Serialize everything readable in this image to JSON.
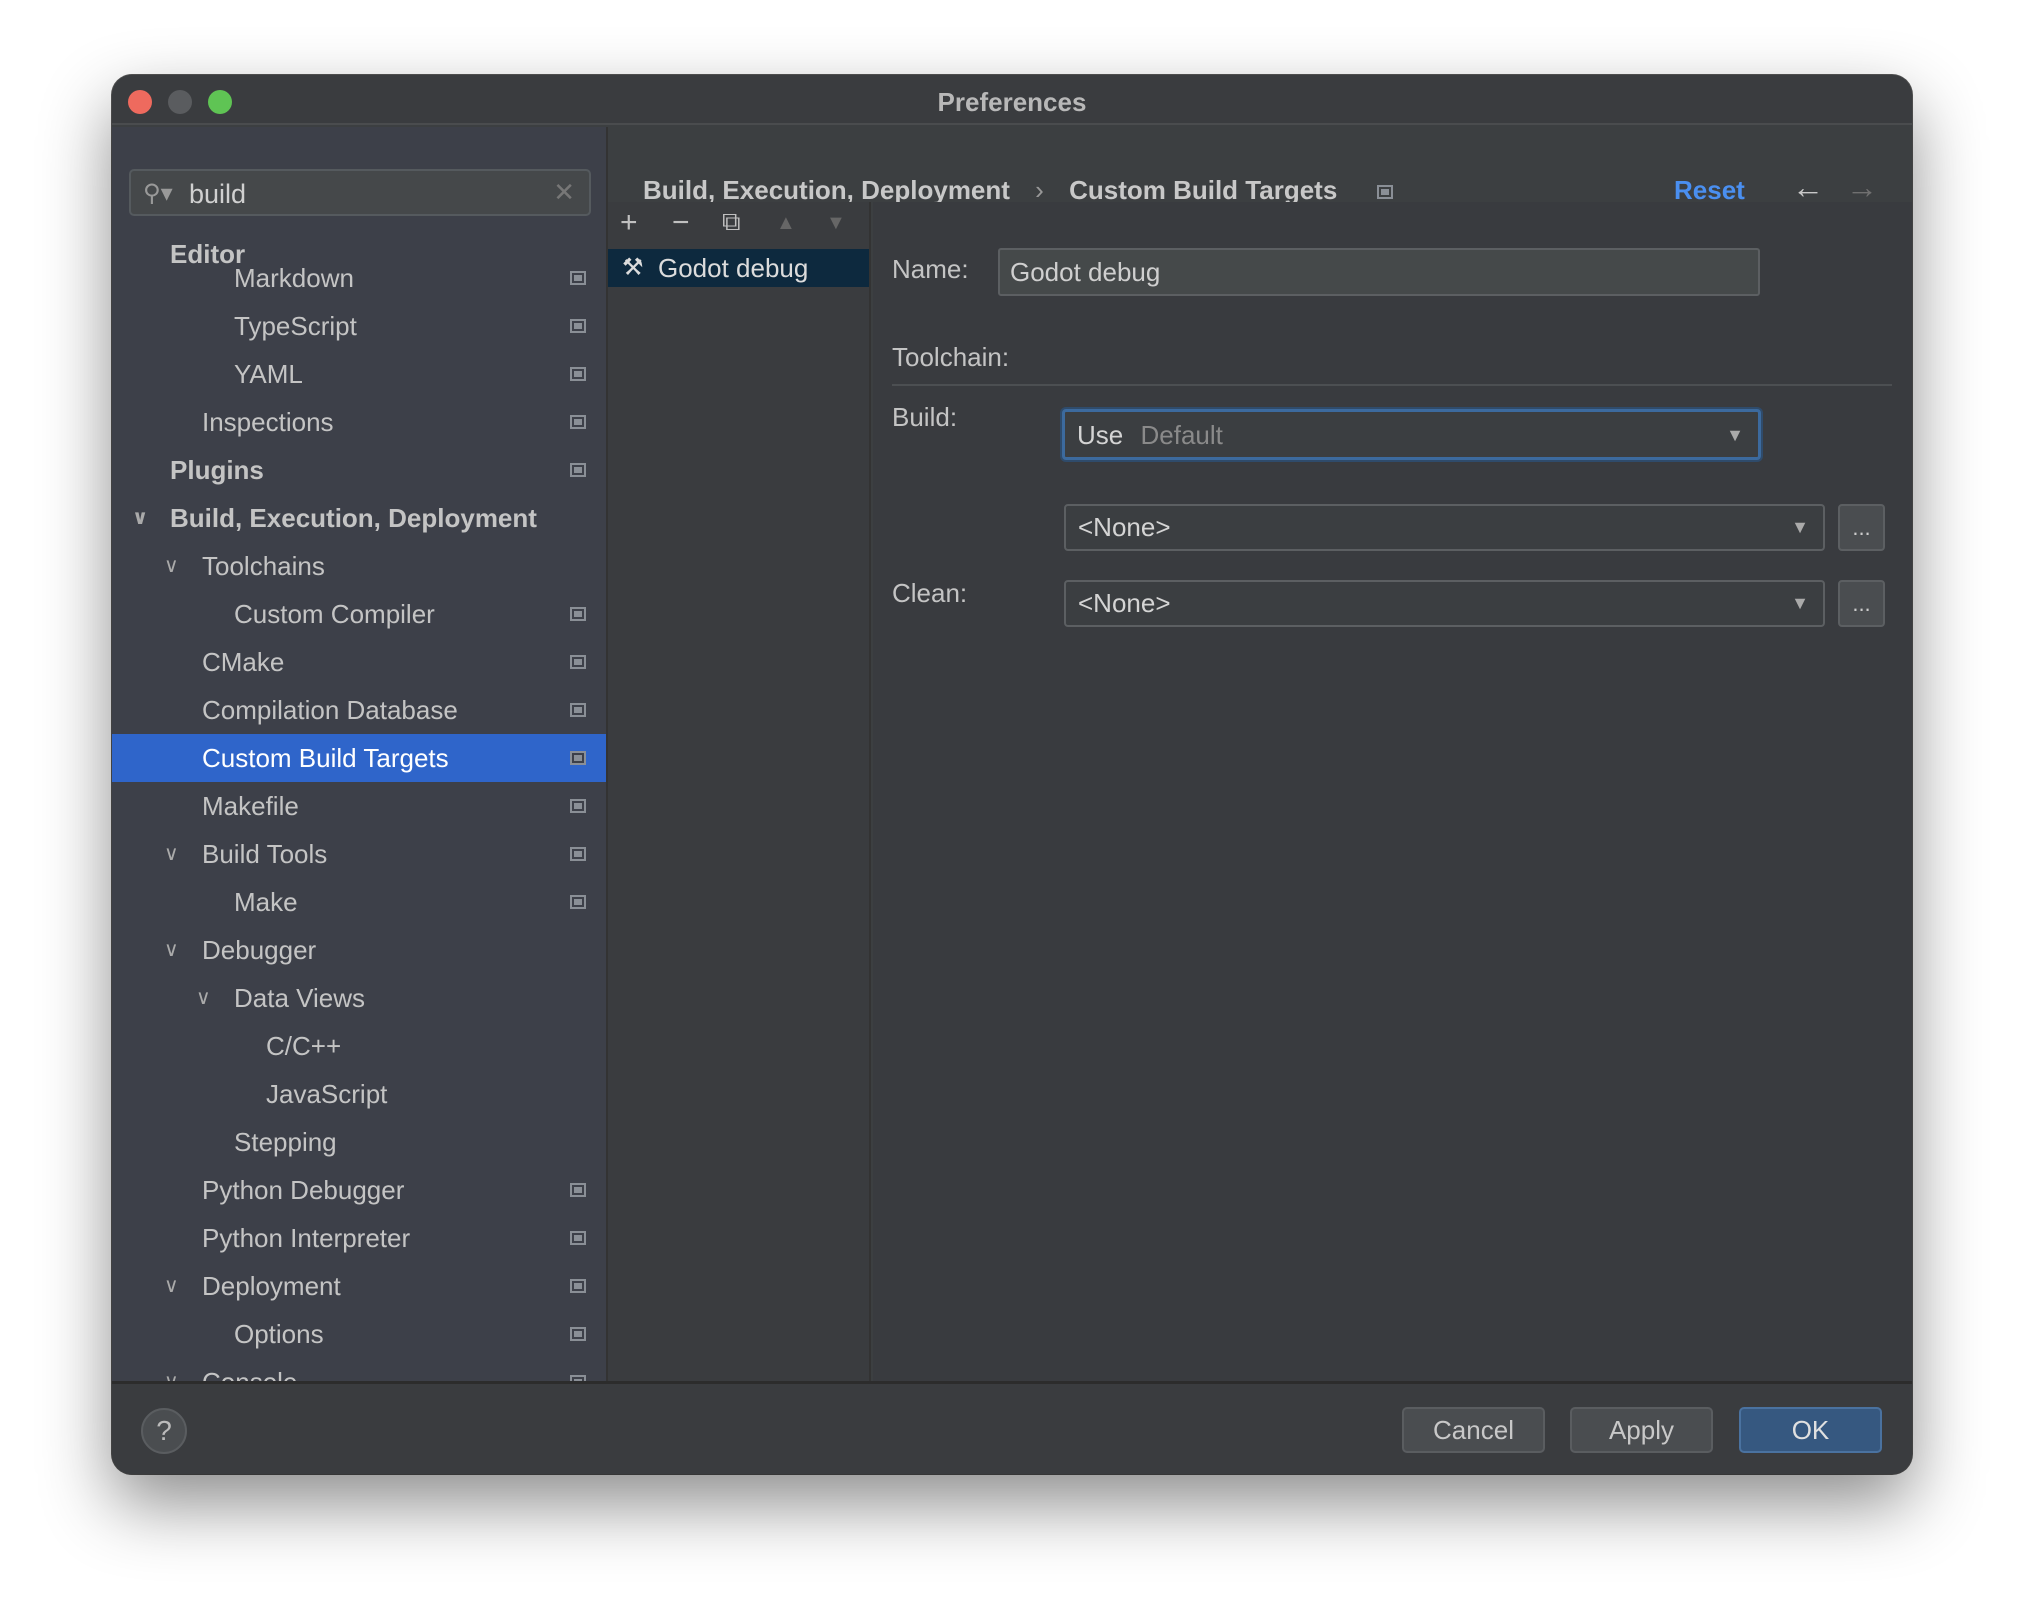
{
  "window": {
    "title": "Preferences",
    "traffic_lights": {
      "close": "#ee6a5e",
      "minimize": "#5a5c5f",
      "zoom": "#5fc454"
    }
  },
  "search": {
    "value": "build",
    "icon": "search-icon",
    "clear_icon": "close-icon"
  },
  "sidebar": {
    "sticky_header": "Editor",
    "selected_color": "#2f65ca",
    "items": [
      {
        "label": "Markdown",
        "level": 3,
        "icon": true
      },
      {
        "label": "TypeScript",
        "level": 3,
        "icon": true
      },
      {
        "label": "YAML",
        "level": 3,
        "icon": true
      },
      {
        "label": "Inspections",
        "level": 2,
        "icon": true
      },
      {
        "label": "Plugins",
        "level": 1,
        "bold": true,
        "icon": true
      },
      {
        "label": "Build, Execution, Deployment",
        "level": 1,
        "bold": true,
        "expanded": true
      },
      {
        "label": "Toolchains",
        "level": 2,
        "expanded": true
      },
      {
        "label": "Custom Compiler",
        "level": 3,
        "icon": true
      },
      {
        "label": "CMake",
        "level": 2,
        "icon": true
      },
      {
        "label": "Compilation Database",
        "level": 2,
        "icon": true
      },
      {
        "label": "Custom Build Targets",
        "level": 2,
        "icon": true,
        "selected": true
      },
      {
        "label": "Makefile",
        "level": 2,
        "icon": true
      },
      {
        "label": "Build Tools",
        "level": 2,
        "expanded": true,
        "icon": true
      },
      {
        "label": "Make",
        "level": 3,
        "icon": true
      },
      {
        "label": "Debugger",
        "level": 2,
        "expanded": true
      },
      {
        "label": "Data Views",
        "level": 3,
        "expanded": true
      },
      {
        "label": "C/C++",
        "level": 4
      },
      {
        "label": "JavaScript",
        "level": 4
      },
      {
        "label": "Stepping",
        "level": 3
      },
      {
        "label": "Python Debugger",
        "level": 2,
        "icon": true
      },
      {
        "label": "Python Interpreter",
        "level": 2,
        "icon": true
      },
      {
        "label": "Deployment",
        "level": 2,
        "expanded": true,
        "icon": true
      },
      {
        "label": "Options",
        "level": 3,
        "icon": true
      },
      {
        "label": "Console",
        "level": 2,
        "expanded": true,
        "icon": true
      }
    ]
  },
  "header": {
    "breadcrumb": [
      "Build, Execution, Deployment",
      "Custom Build Targets"
    ],
    "separator": "›",
    "reset": "Reset",
    "reset_color": "#4a8ff0"
  },
  "targets": {
    "toolbar": [
      "add-icon",
      "remove-icon",
      "copy-icon",
      "move-up-icon",
      "move-down-icon"
    ],
    "items": [
      {
        "label": "Godot debug",
        "icon": "hammer-wrench-icon"
      }
    ]
  },
  "form": {
    "name_label": "Name:",
    "name_value": "Godot debug",
    "toolchain_label": "Toolchain:",
    "toolchain_prefix": "Use",
    "toolchain_value": "Default",
    "build_label": "Build:",
    "build_value": "<None>",
    "clean_label": "Clean:",
    "clean_value": "<None>",
    "browse": "..."
  },
  "footer": {
    "help": "?",
    "cancel": "Cancel",
    "apply": "Apply",
    "ok": "OK"
  }
}
